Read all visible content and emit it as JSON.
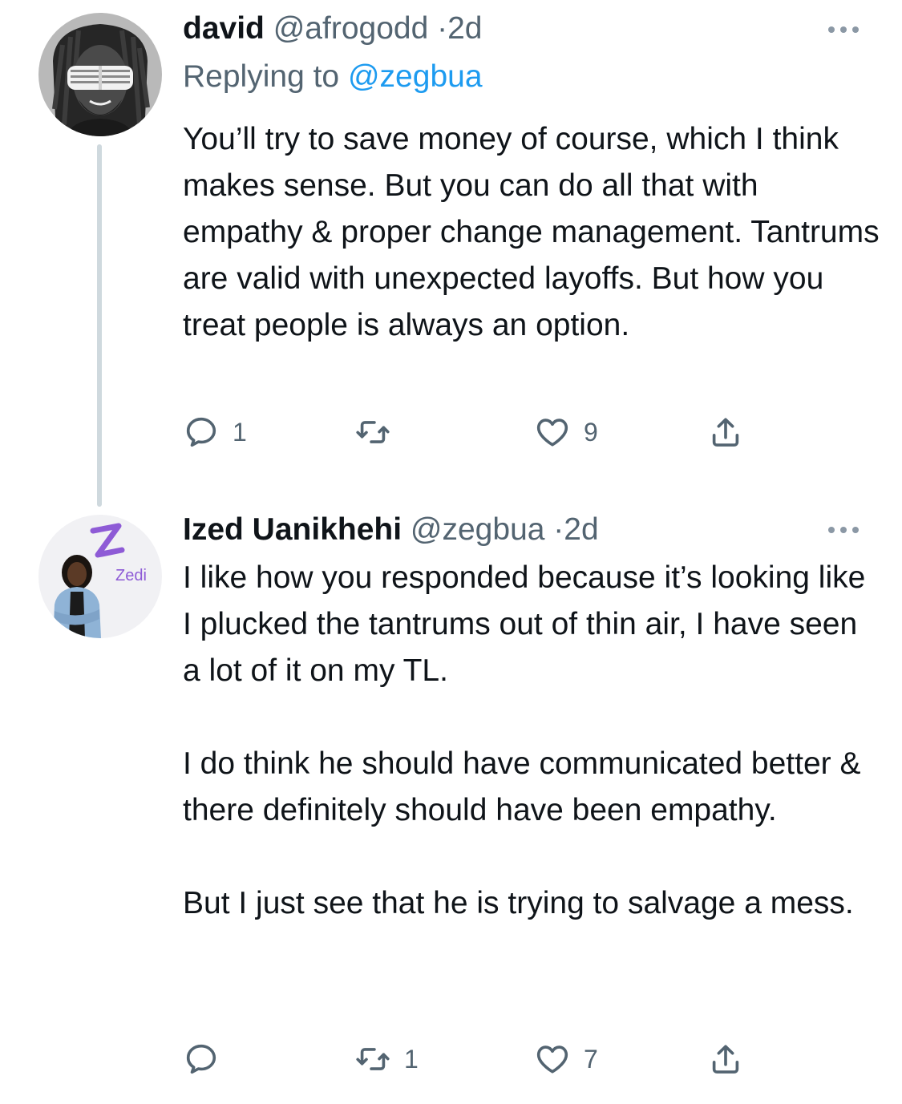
{
  "tweets": [
    {
      "author": {
        "display_name": "david",
        "handle": "@afrogodd",
        "avatar_icon": "avatar-photo-man-shutter-shades"
      },
      "separator": "·",
      "time": "2d",
      "replying_to": {
        "prefix": "Replying to",
        "mention": "@zegbua"
      },
      "text": [
        "You’ll try to save money of course, which I think makes sense. But you can do all that with empathy & proper change management. Tantrums are valid with unexpected layoffs. But how you treat people is always an option."
      ],
      "actions": {
        "reply_count": "1",
        "retweet_count": "",
        "like_count": "9"
      }
    },
    {
      "author": {
        "display_name": "Ized Uanikhehi",
        "handle": "@zegbua",
        "avatar_icon": "avatar-photo-woman-zedi-logo",
        "avatar_logo_text": "Zedi"
      },
      "separator": "·",
      "time": "2d",
      "text": [
        "I like how you responded because it’s looking like I plucked the tantrums out of thin air, I have seen a lot of it on my TL.",
        "I do think he should have communicated better & there definitely should have been empathy.",
        "But I just see that he is trying to salvage a mess."
      ],
      "actions": {
        "reply_count": "",
        "retweet_count": "1",
        "like_count": "7"
      }
    }
  ],
  "icons": {
    "more": "more-horizontal-icon",
    "reply": "reply-bubble-icon",
    "retweet": "retweet-icon",
    "like": "heart-outline-icon",
    "share": "share-upload-icon"
  },
  "colors": {
    "text_primary": "#0f1419",
    "text_secondary": "#536471",
    "mention": "#1d9bf0",
    "thread_line": "#cfd9de",
    "background": "#ffffff"
  }
}
